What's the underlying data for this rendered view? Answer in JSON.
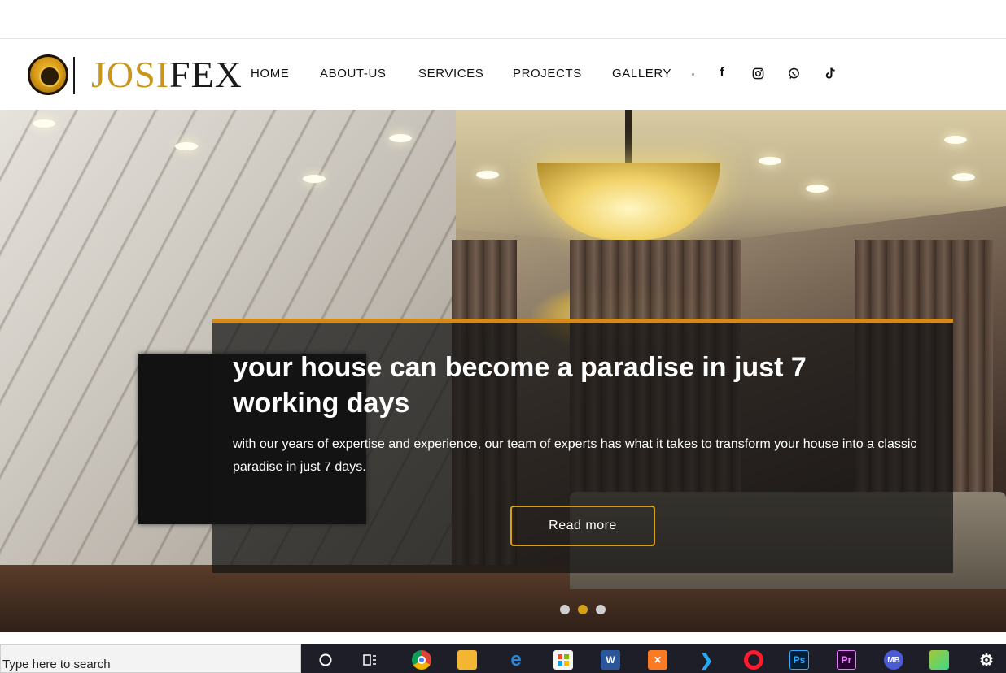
{
  "brand": {
    "part1": "JOSI",
    "part2": "FEX"
  },
  "nav": {
    "items": [
      "HOME",
      "ABOUT-US",
      "SERVICES",
      "PROJECTS",
      "GALLERY"
    ]
  },
  "social": [
    "facebook-icon",
    "instagram-icon",
    "whatsapp-icon",
    "tiktok-icon"
  ],
  "hero": {
    "title": "your house can become a paradise in just 7 working days",
    "text": "with our years of expertise and experience, our team of experts has what it takes to transform your house into a classic paradise in just 7 days.",
    "button": "Read more",
    "slides_total": 3,
    "active_slide": 2
  },
  "taskbar": {
    "search_placeholder": "Type here to search",
    "apps": [
      "cortana-icon",
      "task-view-icon",
      "chrome-icon",
      "file-explorer-icon",
      "edge-icon",
      "store-icon",
      "word-icon",
      "xampp-icon",
      "vscode-icon",
      "opera-icon",
      "photoshop-icon",
      "premiere-icon",
      "mb-icon",
      "android-icon",
      "settings-icon"
    ],
    "app_labels": {
      "photoshop": "Ps",
      "premiere": "Pr",
      "mb": "MB"
    }
  },
  "colors": {
    "accent": "#d4a017",
    "caption_border": "#d4891c",
    "logo_gold": "#c9951f"
  }
}
